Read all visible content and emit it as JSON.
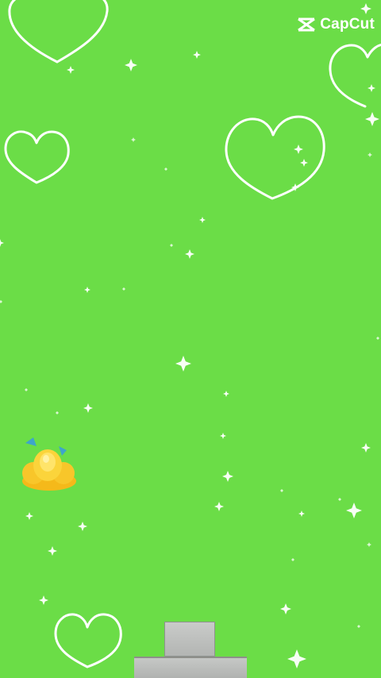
{
  "background_color": "#6BDD47",
  "watermark": {
    "text": "CapCut",
    "icon": "capcut-logo-icon"
  },
  "decorations": {
    "heart_icon": "heart-outline-icon",
    "sparkle_icon": "sparkle-star-icon",
    "flower_icon": "yellow-lotus-flower-icon",
    "stroke_color": "#FFFFFF"
  }
}
